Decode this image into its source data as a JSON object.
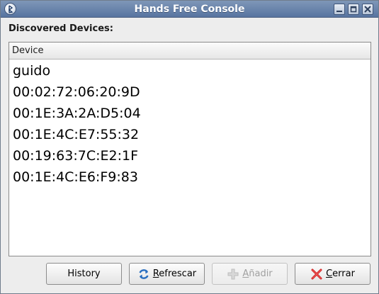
{
  "window": {
    "title": "Hands Free Console",
    "icons": {
      "app": "bluetooth-app-icon",
      "minimize": "minimize-icon",
      "maximize": "maximize-icon",
      "close": "close-icon"
    }
  },
  "main": {
    "heading": "Discovered Devices:",
    "column_header": "Device",
    "devices": [
      "guido",
      "00:02:72:06:20:9D",
      "00:1E:3A:2A:D5:04",
      "00:1E:4C:E7:55:32",
      "00:19:63:7C:E2:1F",
      "00:1E:4C:E6:F9:83"
    ]
  },
  "buttons": {
    "history": {
      "label": "History"
    },
    "refresh": {
      "mnemonic": "R",
      "rest": "efrescar",
      "icon": "refresh-icon"
    },
    "add": {
      "mnemonic": "A",
      "rest": "ñadir",
      "icon": "plus-icon",
      "enabled": false
    },
    "close": {
      "mnemonic": "C",
      "rest": "errar",
      "icon": "close-x-icon"
    }
  },
  "colors": {
    "titlebar": "#5774a0",
    "background": "#ededed",
    "disabled_text": "#a0a0a0",
    "refresh_icon": "#2a6fc0",
    "close_icon": "#d02020"
  }
}
